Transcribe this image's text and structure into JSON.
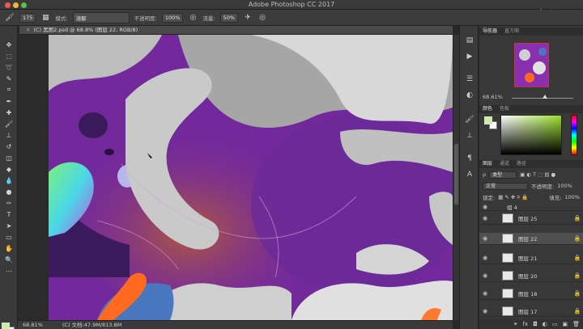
{
  "app": {
    "title": "Adobe Photoshop CC 2017",
    "watermark": "虎课网"
  },
  "options": {
    "brush_size": "175",
    "mode_label": "模式:",
    "mode_value": "溶解",
    "opacity_label": "不透明度:",
    "opacity_value": "100%",
    "flow_label": "流量:",
    "flow_value": "50%"
  },
  "document": {
    "tab_title": "(C) 黑图2.psd @ 68.8% (图层 22, RGB/8)",
    "zoom": "68.81%",
    "file_info": "(C) 文档:47.9M/813.8M"
  },
  "navigator": {
    "tabs": [
      "导航器",
      "直方图"
    ],
    "zoom": "68.61%"
  },
  "color": {
    "tabs": [
      "颜色",
      "色板"
    ],
    "foreground": "#c6f0a0",
    "background": "#ffffff"
  },
  "layers_panel": {
    "tabs": [
      "图层",
      "通道",
      "路径"
    ],
    "filter_label": "类型",
    "blend_mode": "正常",
    "opacity_label": "不透明度:",
    "opacity_value": "100%",
    "lock_label": "锁定:",
    "fill_label": "填充:",
    "fill_value": "100%",
    "group_name": "组 4",
    "layers": [
      {
        "name": "图层 25"
      },
      {
        "name": "图层 22",
        "selected": true
      },
      {
        "name": "图层 21"
      },
      {
        "name": "图层 20"
      },
      {
        "name": "图层 18"
      },
      {
        "name": "图层 17"
      }
    ]
  },
  "icons": {
    "eye": "eye-icon",
    "lock": "lock-icon",
    "brush": "brush-icon"
  }
}
